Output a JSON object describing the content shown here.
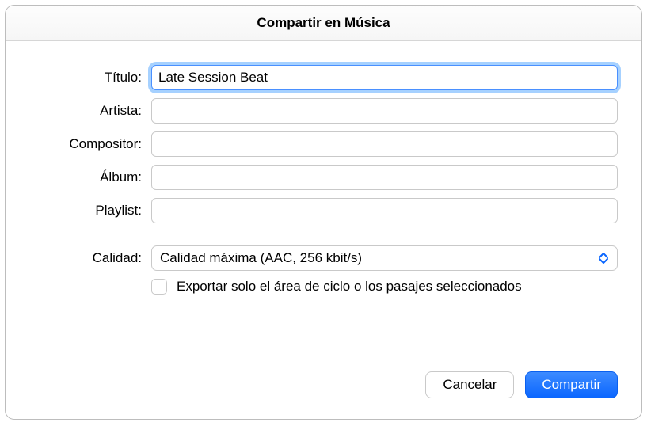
{
  "window": {
    "title": "Compartir en Música"
  },
  "form": {
    "title": {
      "label": "Título:",
      "value": "Late Session Beat"
    },
    "artist": {
      "label": "Artista:",
      "value": ""
    },
    "composer": {
      "label": "Compositor:",
      "value": ""
    },
    "album": {
      "label": "Álbum:",
      "value": ""
    },
    "playlist": {
      "label": "Playlist:",
      "value": ""
    },
    "quality": {
      "label": "Calidad:",
      "selected": "Calidad máxima (AAC, 256 kbit/s)"
    },
    "export_cycle": {
      "label": "Exportar solo el área de ciclo o los pasajes seleccionados",
      "checked": false
    }
  },
  "footer": {
    "cancel": "Cancelar",
    "share": "Compartir"
  }
}
